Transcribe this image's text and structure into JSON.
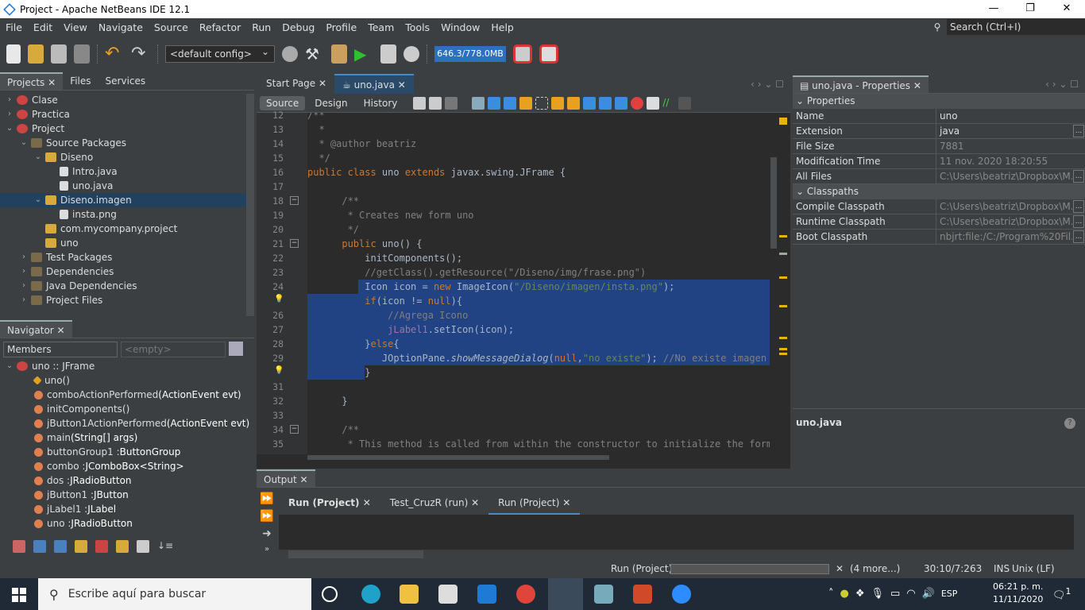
{
  "window": {
    "title": "Project - Apache NetBeans IDE 12.1",
    "minimize": "—",
    "maximize": "❐",
    "close": "✕"
  },
  "menu": [
    "File",
    "Edit",
    "View",
    "Navigate",
    "Source",
    "Refactor",
    "Run",
    "Debug",
    "Profile",
    "Team",
    "Tools",
    "Window",
    "Help"
  ],
  "search": {
    "placeholder": "Search (Ctrl+I)"
  },
  "toolbar": {
    "config": "<default config>",
    "memory": "646.3/778.0MB"
  },
  "projects_panel": {
    "tabs": [
      "Projects",
      "Files",
      "Services"
    ],
    "tree": [
      {
        "label": "Clase",
        "depth": 0,
        "exp": "›",
        "icon": "proj"
      },
      {
        "label": "Practica",
        "depth": 0,
        "exp": "›",
        "icon": "proj"
      },
      {
        "label": "Project",
        "depth": 0,
        "exp": "⌄",
        "icon": "proj"
      },
      {
        "label": "Source Packages",
        "depth": 1,
        "exp": "⌄",
        "icon": "folder"
      },
      {
        "label": "Diseno",
        "depth": 2,
        "exp": "⌄",
        "icon": "pkg"
      },
      {
        "label": "Intro.java",
        "depth": 3,
        "exp": "",
        "icon": "file"
      },
      {
        "label": "uno.java",
        "depth": 3,
        "exp": "",
        "icon": "file"
      },
      {
        "label": "Diseno.imagen",
        "depth": 2,
        "exp": "⌄",
        "icon": "pkg",
        "selected": true
      },
      {
        "label": "insta.png",
        "depth": 3,
        "exp": "",
        "icon": "file"
      },
      {
        "label": "com.mycompany.project",
        "depth": 2,
        "exp": "",
        "icon": "pkg"
      },
      {
        "label": "uno",
        "depth": 2,
        "exp": "",
        "icon": "pkg"
      },
      {
        "label": "Test Packages",
        "depth": 1,
        "exp": "›",
        "icon": "folder"
      },
      {
        "label": "Dependencies",
        "depth": 1,
        "exp": "›",
        "icon": "folder"
      },
      {
        "label": "Java Dependencies",
        "depth": 1,
        "exp": "›",
        "icon": "folder"
      },
      {
        "label": "Project Files",
        "depth": 1,
        "exp": "›",
        "icon": "folder"
      }
    ]
  },
  "navigator": {
    "title": "Navigator",
    "members": "Members",
    "filter": "<empty>",
    "root": "uno :: JFrame",
    "items": [
      {
        "name": "uno()",
        "type": "",
        "icon": "ctor"
      },
      {
        "name": "comboActionPerformed",
        "type": "(ActionEvent evt)",
        "icon": "meth"
      },
      {
        "name": "initComponents()",
        "type": "",
        "icon": "meth"
      },
      {
        "name": "jButton1ActionPerformed",
        "type": "(ActionEvent evt)",
        "icon": "meth"
      },
      {
        "name": "main",
        "type": "(String[] args)",
        "icon": "meth"
      },
      {
        "name": "buttonGroup1 : ",
        "type": "ButtonGroup",
        "icon": "meth"
      },
      {
        "name": "combo : ",
        "type": "JComboBox<String>",
        "icon": "meth"
      },
      {
        "name": "dos : ",
        "type": "JRadioButton",
        "icon": "meth"
      },
      {
        "name": "jButton1 : ",
        "type": "JButton",
        "icon": "meth"
      },
      {
        "name": "jLabel1 : ",
        "type": "JLabel",
        "icon": "meth"
      },
      {
        "name": "uno : ",
        "type": "JRadioButton",
        "icon": "meth"
      }
    ]
  },
  "editor": {
    "tabs": [
      "Start Page",
      "uno.java"
    ],
    "views": [
      "Source",
      "Design",
      "History"
    ],
    "lines": [
      {
        "n": "12",
        "s": [
          [
            "cm",
            "/**"
          ]
        ]
      },
      {
        "n": "13",
        "s": [
          [
            "cm",
            "  *"
          ]
        ]
      },
      {
        "n": "14",
        "s": [
          [
            "cm",
            "  * @author beatriz"
          ]
        ]
      },
      {
        "n": "15",
        "s": [
          [
            "cm",
            "  */"
          ]
        ]
      },
      {
        "n": "16",
        "s": [
          [
            "kw",
            "public class "
          ],
          [
            "pl",
            "uno "
          ],
          [
            "kw",
            "extends "
          ],
          [
            "pl",
            "javax.swing.JFrame {"
          ]
        ]
      },
      {
        "n": "17",
        "s": []
      },
      {
        "n": "18",
        "s": [
          [
            "cm",
            "      /**"
          ]
        ]
      },
      {
        "n": "19",
        "s": [
          [
            "cm",
            "       * Creates new form uno"
          ]
        ]
      },
      {
        "n": "20",
        "s": [
          [
            "cm",
            "       */"
          ]
        ]
      },
      {
        "n": "21",
        "s": [
          [
            "kw",
            "      public "
          ],
          [
            "pl",
            "uno() {"
          ]
        ]
      },
      {
        "n": "22",
        "s": [
          [
            "pl",
            "          initComponents();"
          ]
        ]
      },
      {
        "n": "23",
        "s": [
          [
            "cm",
            "          //getClass().getResource(\"/Diseno/img/frase.png\")"
          ]
        ]
      },
      {
        "n": "24",
        "s": [
          [
            "pl",
            "          Icon icon = "
          ],
          [
            "kw",
            "new "
          ],
          [
            "pl",
            "ImageIcon("
          ],
          [
            "st",
            "\"/Diseno/imagen/insta.png\""
          ],
          [
            "pl",
            ");"
          ]
        ],
        "sel": "partial"
      },
      {
        "n": "",
        "s": [
          [
            "kw",
            "          if"
          ],
          [
            "pl",
            "(icon != "
          ],
          [
            "kw",
            "null"
          ],
          [
            "pl",
            "){"
          ]
        ],
        "sel": "full"
      },
      {
        "n": "26",
        "s": [
          [
            "cm",
            "              //Agrega Icono"
          ]
        ],
        "sel": "full"
      },
      {
        "n": "27",
        "s": [
          [
            "fld",
            "              jLabel1"
          ],
          [
            "pl",
            ".setIcon(icon);"
          ]
        ],
        "sel": "full"
      },
      {
        "n": "28",
        "s": [
          [
            "pl",
            "          }"
          ],
          [
            "kw",
            "else"
          ],
          [
            "pl",
            "{"
          ]
        ],
        "sel": "full"
      },
      {
        "n": "29",
        "s": [
          [
            "pl",
            "             JOptionPane."
          ],
          [
            "it",
            "showMessageDialog"
          ],
          [
            "pl",
            "("
          ],
          [
            "kw",
            "null"
          ],
          [
            "pl",
            ","
          ],
          [
            "st",
            "\"no existe\""
          ],
          [
            "pl",
            "); "
          ],
          [
            "cm",
            "//No existe imagen"
          ]
        ],
        "sel": "full"
      },
      {
        "n": "",
        "s": [
          [
            "pl",
            "          }"
          ]
        ],
        "sel": "end"
      },
      {
        "n": "31",
        "s": []
      },
      {
        "n": "32",
        "s": [
          [
            "pl",
            "      }"
          ]
        ]
      },
      {
        "n": "33",
        "s": []
      },
      {
        "n": "34",
        "s": [
          [
            "cm",
            "      /**"
          ]
        ]
      },
      {
        "n": "35",
        "s": [
          [
            "cm",
            "       * This method is called from within the constructor to initialize the form."
          ]
        ]
      }
    ]
  },
  "properties": {
    "title": "uno.java - Properties",
    "sections": [
      {
        "name": "Properties",
        "rows": [
          {
            "k": "Name",
            "v": "uno",
            "on": true
          },
          {
            "k": "Extension",
            "v": "java",
            "on": true,
            "btn": true
          },
          {
            "k": "File Size",
            "v": "7881"
          },
          {
            "k": "Modification Time",
            "v": "11 nov. 2020 18:20:55"
          },
          {
            "k": "All Files",
            "v": "C:\\Users\\beatriz\\Dropbox\\M...",
            "btn": true
          }
        ]
      },
      {
        "name": "Classpaths",
        "rows": [
          {
            "k": "Compile Classpath",
            "v": "C:\\Users\\beatriz\\Dropbox\\M...",
            "btn": true
          },
          {
            "k": "Runtime Classpath",
            "v": "C:\\Users\\beatriz\\Dropbox\\M...",
            "btn": true
          },
          {
            "k": "Boot Classpath",
            "v": "nbjrt:file:/C:/Program%20Fil...",
            "btn": true
          }
        ]
      }
    ],
    "description_title": "uno.java"
  },
  "output": {
    "title": "Output",
    "tabs": [
      "Run (Project)",
      "Test_CruzR (run)",
      "Run (Project)"
    ]
  },
  "status": {
    "task": "Run (Project)",
    "more": "(4 more...)",
    "position": "30:10/7:263",
    "mode": "INS",
    "line_end": "Unix (LF)"
  },
  "taskbar": {
    "search": "Escribe aquí para buscar",
    "lang": "ESP",
    "time": "06:21 p. m.",
    "date": "11/11/2020",
    "notif": "1"
  },
  "colors": {
    "selection": "#214283",
    "accent": "#2e6fbe",
    "keyword": "#cc7832",
    "string": "#6a8759",
    "comment": "#808080"
  }
}
